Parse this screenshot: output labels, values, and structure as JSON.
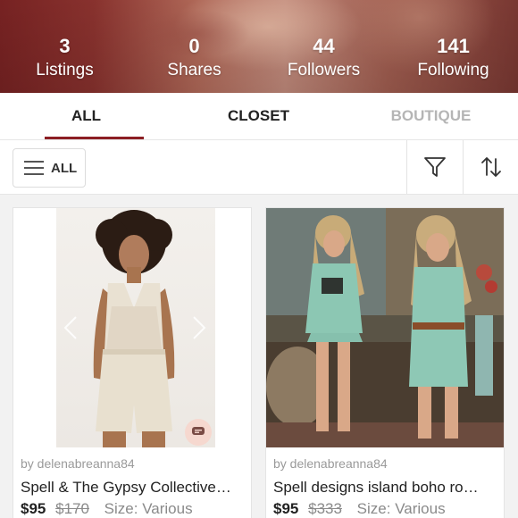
{
  "profile": {
    "stats": [
      {
        "value": "3",
        "label": "Listings"
      },
      {
        "value": "0",
        "label": "Shares"
      },
      {
        "value": "44",
        "label": "Followers"
      },
      {
        "value": "141",
        "label": "Following"
      }
    ]
  },
  "tabs": [
    {
      "label": "ALL",
      "active": true
    },
    {
      "label": "CLOSET",
      "active": false
    },
    {
      "label": "BOUTIQUE",
      "active": false
    }
  ],
  "toolbar": {
    "filter_label": "ALL",
    "icons": [
      "menu-icon",
      "filter-icon",
      "sort-icon"
    ]
  },
  "listings": [
    {
      "seller": "by delenabreanna84",
      "title": "Spell & The Gypsy Collective…",
      "price": "$95",
      "original_price": "$170",
      "size": "Size: Various"
    },
    {
      "seller": "by delenabreanna84",
      "title": "Spell designs island boho ro…",
      "price": "$95",
      "original_price": "$333",
      "size": "Size: Various"
    }
  ],
  "colors": {
    "accent": "#8c1f24",
    "muted_tab": "#b5b5b5"
  }
}
